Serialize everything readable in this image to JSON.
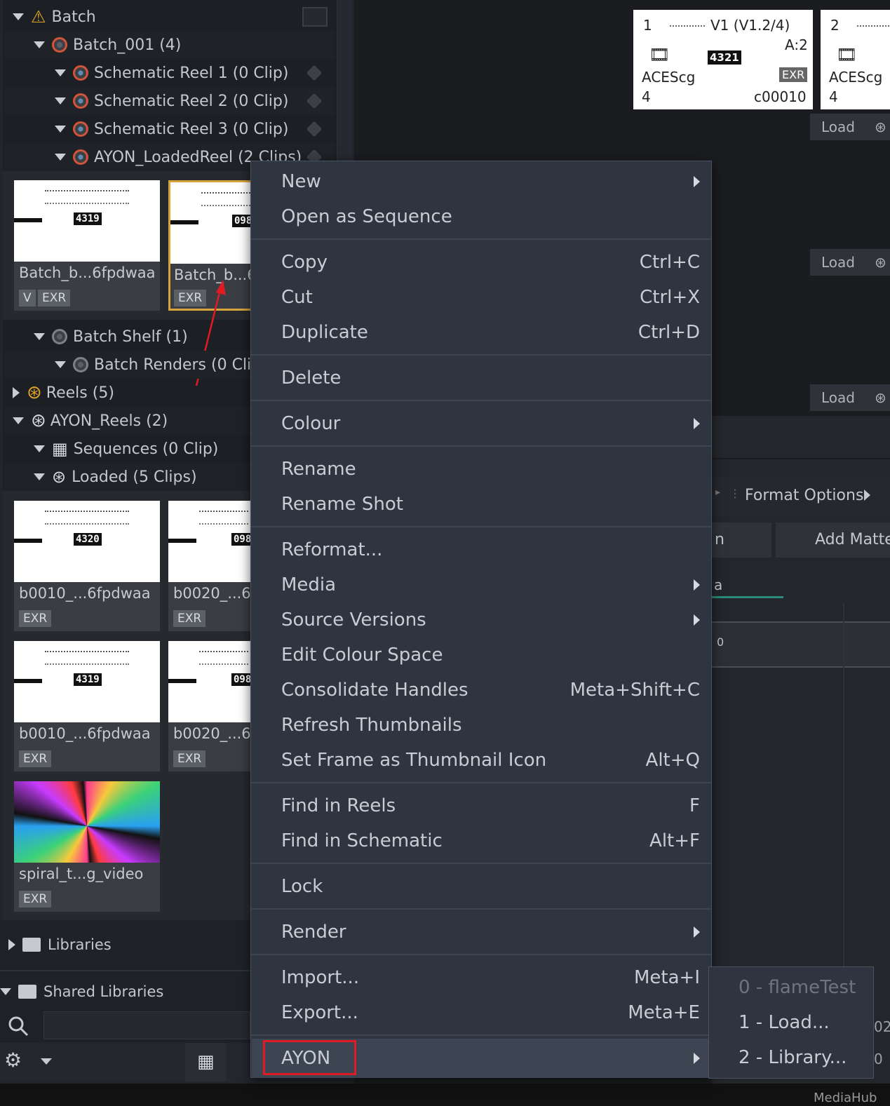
{
  "tree": {
    "batch": "Batch",
    "batch_001": "Batch_001 (4)",
    "reel1": "Schematic Reel 1 (0 Clip)",
    "reel2": "Schematic Reel 2 (0 Clip)",
    "reel3": "Schematic Reel 3 (0 Clip)",
    "loaded_reel": "AYON_LoadedReel (2 Clips)",
    "batch_shelf": "Batch Shelf (1)",
    "batch_renders": "Batch Renders (0 Clip)",
    "reels": "Reels (5)",
    "ayon_reels": "AYON_Reels (2)",
    "sequences": "Sequences (0 Clip)",
    "loaded": "Loaded (5 Clips)",
    "libraries": "Libraries",
    "shared_libraries": "Shared Libraries"
  },
  "thumbs": [
    {
      "label": "Batch_b...6fpdwaa",
      "frame": "4319",
      "badges": [
        "V",
        "EXR"
      ]
    },
    {
      "label": "Batch_b...6f",
      "frame": "098",
      "badges": [
        "EXR"
      ]
    },
    {
      "label": "b0010_...6fpdwaa",
      "frame": "4320",
      "badges": [
        "EXR"
      ]
    },
    {
      "label": "b0020_...6f",
      "frame": "098",
      "badges": [
        "EXR"
      ]
    },
    {
      "label": "b0010_...6fpdwaa",
      "frame": "4319",
      "badges": [
        "EXR"
      ]
    },
    {
      "label": "b0020_...6f",
      "frame": "098",
      "badges": [
        "EXR"
      ]
    },
    {
      "label": "spiral_t...g_video",
      "badges": [
        "EXR"
      ]
    }
  ],
  "cards": [
    {
      "num": "1",
      "version": "V1 (V1.2/4)",
      "audio": "A:2",
      "frame": "4321",
      "colorspace": "ACEScg",
      "bottom_num": "4",
      "fmt": "EXR",
      "code": "c00010"
    },
    {
      "num": "2",
      "colorspace": "ACEScg",
      "bottom_num": "4"
    }
  ],
  "right": {
    "load": "Load",
    "format_options": "Format Options",
    "add_matte": "Add Matte",
    "partial_n": "n",
    "partial_a": "a",
    "zero": "0",
    "partial_02": "02",
    "partial_0": "0",
    "mediahub": "MediaHub"
  },
  "menu": {
    "items": [
      {
        "label": "New"
      },
      {
        "label": "Open as Sequence"
      },
      {
        "label": "Copy",
        "shortcut": "Ctrl+C"
      },
      {
        "label": "Cut",
        "shortcut": "Ctrl+X"
      },
      {
        "label": "Duplicate",
        "shortcut": "Ctrl+D"
      },
      {
        "label": "Delete"
      },
      {
        "label": "Colour"
      },
      {
        "label": "Rename"
      },
      {
        "label": "Rename Shot"
      },
      {
        "label": "Reformat..."
      },
      {
        "label": "Media"
      },
      {
        "label": "Source Versions"
      },
      {
        "label": "Edit Colour Space"
      },
      {
        "label": "Consolidate Handles",
        "shortcut": "Meta+Shift+C"
      },
      {
        "label": "Refresh Thumbnails"
      },
      {
        "label": "Set Frame as Thumbnail Icon",
        "shortcut": "Alt+Q"
      },
      {
        "label": "Find in Reels",
        "shortcut": "F"
      },
      {
        "label": "Find in Schematic",
        "shortcut": "Alt+F"
      },
      {
        "label": "Lock"
      },
      {
        "label": "Render"
      },
      {
        "label": "Import...",
        "shortcut": "Meta+I"
      },
      {
        "label": "Export...",
        "shortcut": "Meta+E"
      },
      {
        "label": "AYON"
      }
    ]
  },
  "submenu": {
    "items": [
      {
        "label": "0 - flameTest"
      },
      {
        "label": "1 - Load..."
      },
      {
        "label": "2 - Library..."
      }
    ]
  },
  "colors": {
    "accent_red": "#e01b24",
    "selection": "#d7a43c",
    "menu_bg": "#2e3440"
  }
}
